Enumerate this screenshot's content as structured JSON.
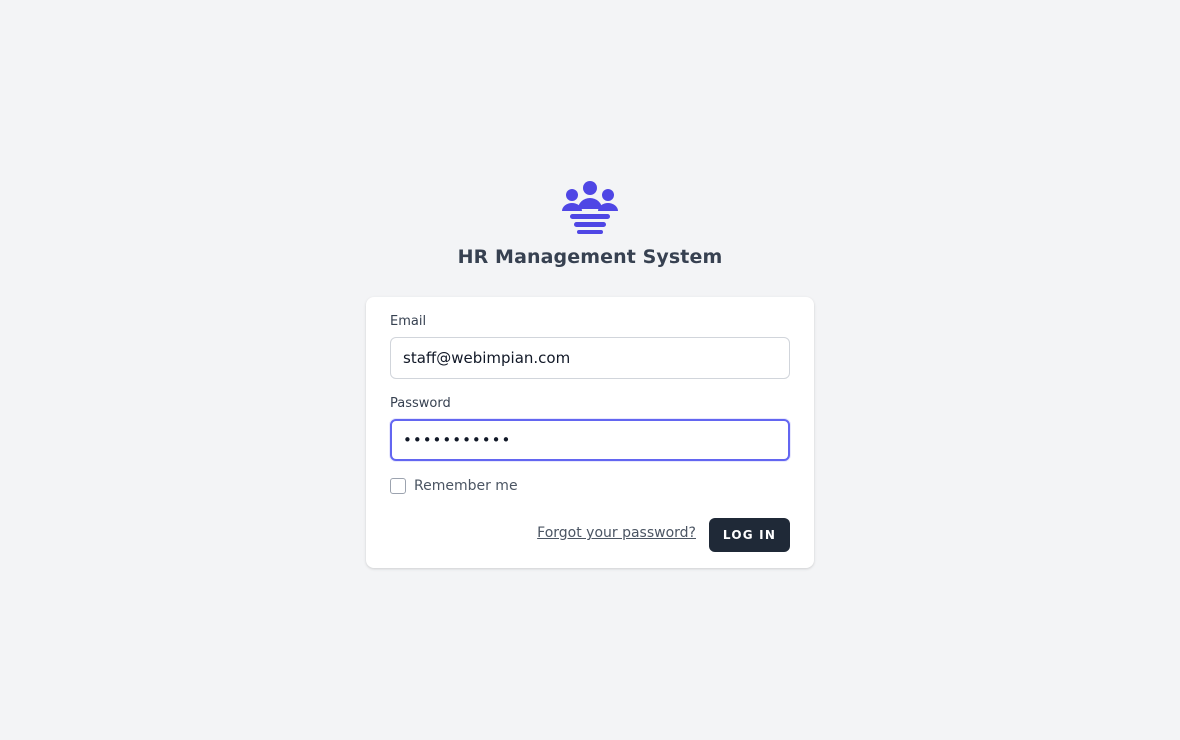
{
  "app": {
    "title": "HR Management System",
    "logo_icon": "people-group-icon",
    "brand_color": "#4f46e5"
  },
  "form": {
    "email_label": "Email",
    "email_value": "staff@webimpian.com",
    "password_label": "Password",
    "password_value": "•••••••••••",
    "remember_label": "Remember me",
    "remember_checked": false,
    "forgot_label": "Forgot your password?",
    "login_label": "LOG IN"
  },
  "colors": {
    "background": "#f3f4f6",
    "card": "#ffffff",
    "button": "#1f2937",
    "focus_ring": "#6366f1"
  }
}
